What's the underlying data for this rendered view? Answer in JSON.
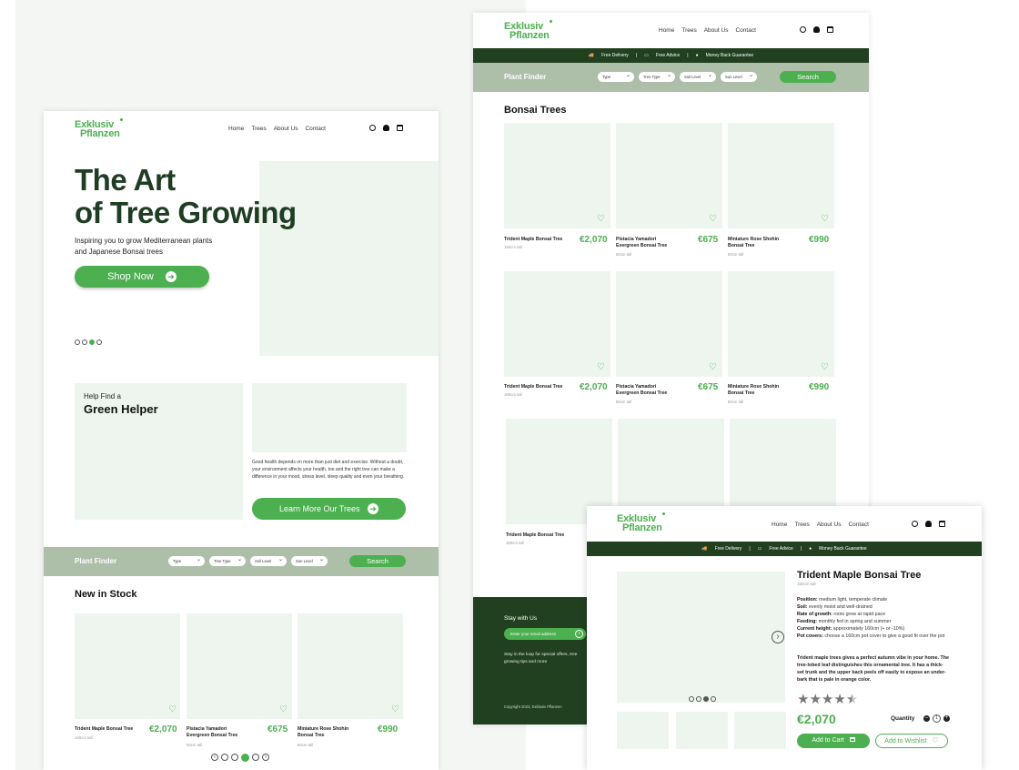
{
  "common": {
    "brand_line1": "Exklusiv",
    "brand_line2": "Pflanzen",
    "nav": [
      "Home",
      "Trees",
      "About Us",
      "Contact"
    ],
    "benefits": [
      "Free Delivery",
      "Free Advice",
      "Money Back Guarantee"
    ],
    "finder_title": "Plant Finder",
    "filters": [
      "Type",
      "Tree Type",
      "Soil Level",
      "Sun Level"
    ],
    "search_label": "Search"
  },
  "home": {
    "hero_line1": "The Art",
    "hero_line2": "of Tree Growing",
    "hero_sub1": "Inspiring you to grow Mediterranean plants",
    "hero_sub2": "and Japanese Bonsai trees",
    "shop_btn": "Shop Now",
    "helper_small": "Help Find a",
    "helper_big": "Green Helper",
    "helper_text": "Good health depends on more than just diet and exercise. Without a doubt, your environment affects your health, too and the right tree can make a difference in your mood, stress level, sleep quality and even your breathing.",
    "learn_btn": "Learn More Our Trees",
    "new_title": "New in Stock",
    "products": [
      {
        "name": "Trident Maple Bonsai Tree",
        "sub": "160cm tall",
        "price": "€2,070"
      },
      {
        "name": "Pistacia Yamadori Evergreen Bonsai Tree",
        "sub": "50cm tall",
        "price": "€675"
      },
      {
        "name": "Miniature Rose Shohin Bonsai Tree",
        "sub": "60cm tall",
        "price": "€990"
      }
    ]
  },
  "listing": {
    "title": "Bonsai Trees",
    "rows": [
      [
        {
          "name": "Trident Maple Bonsai Tree",
          "sub": "160cm tall",
          "price": "€2,070"
        },
        {
          "name": "Pistacia Yamadori Evergreen Bonsai Tree",
          "sub": "50cm tall",
          "price": "€675"
        },
        {
          "name": "Miniature Rose Shohin Bonsai Tree",
          "sub": "60cm tall",
          "price": "€990"
        }
      ],
      [
        {
          "name": "Trident Maple Bonsai Tree",
          "sub": "160cm tall",
          "price": "€2,070"
        },
        {
          "name": "Pistacia Yamadori Evergreen Bonsai Tree",
          "sub": "50cm tall",
          "price": "€675"
        },
        {
          "name": "Miniature Rose Shohin Bonsai Tree",
          "sub": "60cm tall",
          "price": "€990"
        }
      ]
    ],
    "row3_name": "Trident Maple Bonsai Tree",
    "row3_sub": "160cm tall",
    "footer_title": "Stay with Us",
    "footer_placeholder": "Enter your email address",
    "footer_text": "Stay in the loop for special offers, tree growing tips and more",
    "copyright": "Copyright 2023, Exklusiv Pflanzen"
  },
  "product": {
    "name": "Trident Maple Bonsai Tree",
    "sub": "160cm tall",
    "specs": [
      {
        "k": "Position:",
        "v": "medium light, temperate climate"
      },
      {
        "k": "Soil:",
        "v": "evenly moist and well-drained"
      },
      {
        "k": "Rate of growth:",
        "v": "roots grow at rapid pace"
      },
      {
        "k": "Feeding:",
        "v": "monthly fed in spring and summer"
      },
      {
        "k": "Current height:",
        "v": "approximately 160cm (+ or -10%)"
      },
      {
        "k": "Pot covers:",
        "v": "choose a 160cm pot cover to give a good fit over the pot"
      }
    ],
    "description": "Trident maple trees gives a perfect autumn vibe in your home. The tree-lobed leaf distinguishes this ornamental tree. It has a thick-set trunk and the upper back peels off easily to expose an under-bark that is pale in orange color.",
    "rating": 4.5,
    "price": "€2,070",
    "quantity_label": "Quantity",
    "quantity": "1",
    "cart_btn": "Add to Cart",
    "wish_btn": "Add to Wishlist"
  },
  "colors": {
    "green": "#4caf50",
    "dark_green": "#20401f",
    "sage": "#aebfa9",
    "placeholder": "#eef5ee"
  }
}
